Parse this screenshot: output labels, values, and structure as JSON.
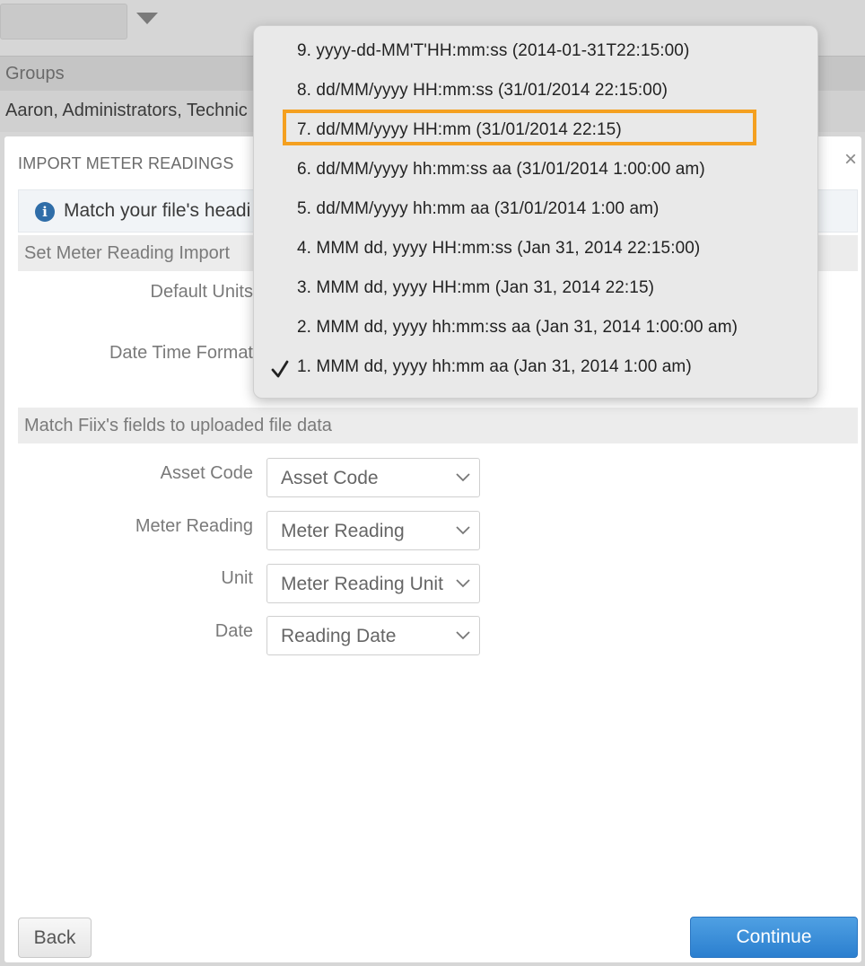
{
  "background": {
    "groups_header": "Groups",
    "groups_value": "Aaron, Administrators, Technic"
  },
  "modal": {
    "title": "IMPORT METER READINGS",
    "close_glyph": "×",
    "info_text": "Match your file's headi",
    "section1_title": "Set Meter Reading Import",
    "default_units_label": "Default Units",
    "date_time_format_label": "Date Time Format",
    "section2_title": "Match Fiix's fields to uploaded file data",
    "fields": [
      {
        "label": "Asset Code",
        "value": "Asset Code"
      },
      {
        "label": "Meter Reading",
        "value": "Meter Reading"
      },
      {
        "label": "Unit",
        "value": "Meter Reading Unit"
      },
      {
        "label": "Date",
        "value": "Reading Date"
      }
    ],
    "back_label": "Back",
    "continue_label": "Continue"
  },
  "dropdown": {
    "options": [
      "9. yyyy-dd-MM'T'HH:mm:ss (2014-01-31T22:15:00)",
      "8. dd/MM/yyyy HH:mm:ss (31/01/2014 22:15:00)",
      "7. dd/MM/yyyy HH:mm (31/01/2014 22:15)",
      "6. dd/MM/yyyy hh:mm:ss aa (31/01/2014 1:00:00 am)",
      "5. dd/MM/yyyy hh:mm aa (31/01/2014 1:00 am)",
      "4. MMM dd, yyyy HH:mm:ss (Jan 31, 2014 22:15:00)",
      "3. MMM dd, yyyy HH:mm (Jan 31, 2014 22:15)",
      "2. MMM dd, yyyy hh:mm:ss aa (Jan 31, 2014 1:00:00 am)",
      "1. MMM dd, yyyy hh:mm aa (Jan 31, 2014 1:00 am)"
    ],
    "checked_option": "1. MMM dd, yyyy hh:mm aa (Jan 31, 2014 1:00 am)",
    "highlighted_option": "7. dd/MM/yyyy HH:mm (31/01/2014 22:15)",
    "highlight_color": "#f4a020"
  },
  "colors": {
    "continue_button": "#2b7fcf",
    "info_icon": "#2f6da8"
  }
}
